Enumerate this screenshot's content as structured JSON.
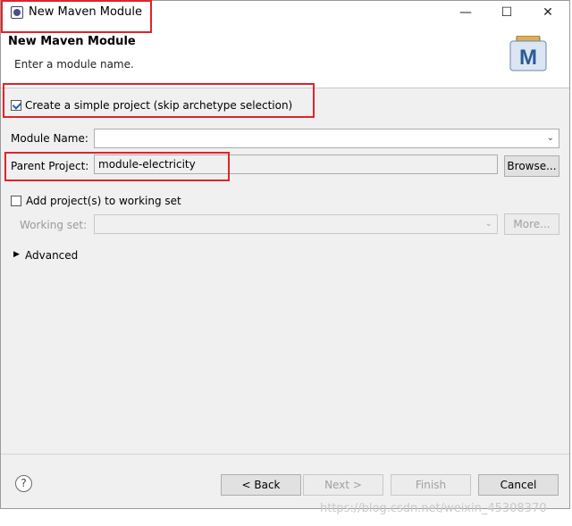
{
  "window": {
    "title": "New Maven Module",
    "controls": {
      "minimize": "—",
      "maximize": "☐",
      "close": "✕"
    }
  },
  "header": {
    "title": "New Maven Module",
    "description": "Enter a module name.",
    "logo_letter": "M"
  },
  "form": {
    "simple_project": {
      "label": "Create a simple project (skip archetype selection)",
      "checked": true
    },
    "module_name": {
      "label": "Module Name:",
      "value": ""
    },
    "parent_project": {
      "label": "Parent Project:",
      "value": "module-electricity",
      "browse_label": "Browse..."
    },
    "working_set_toggle": {
      "label": "Add project(s) to working set",
      "checked": false
    },
    "working_set": {
      "label": "Working set:",
      "value": "",
      "more_label": "More..."
    },
    "advanced_label": "Advanced"
  },
  "footer": {
    "help_label": "?",
    "back_label": "< Back",
    "next_label": "Next >",
    "finish_label": "Finish",
    "cancel_label": "Cancel"
  },
  "watermark": "https://blog.csdn.net/weixin_45308370",
  "colors": {
    "highlight": "#e0232b",
    "accent": "#1f5fa8"
  }
}
